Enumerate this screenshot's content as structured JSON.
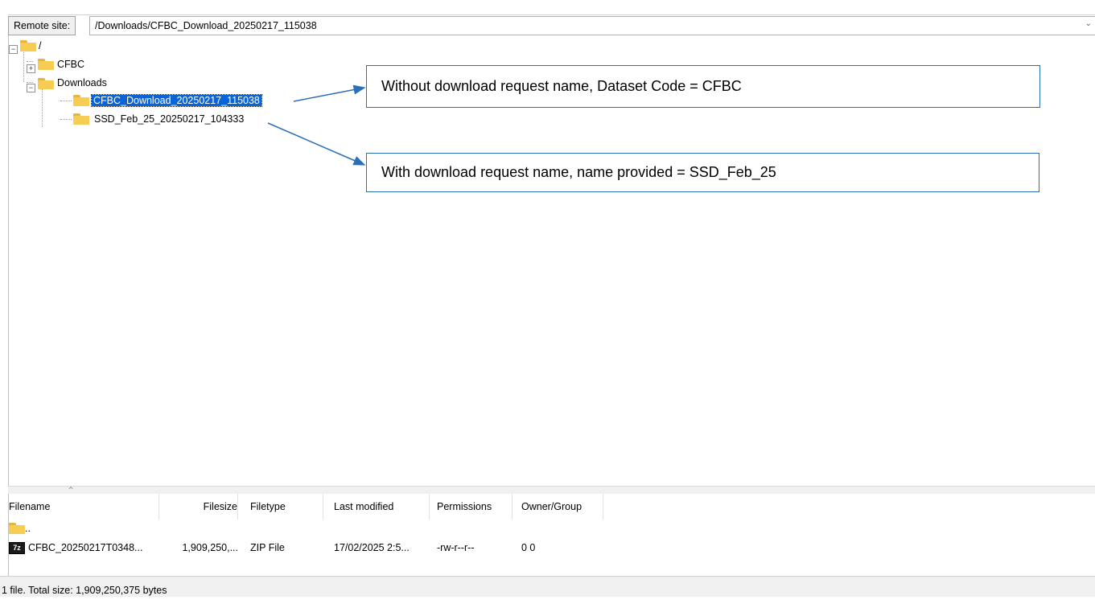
{
  "remote_site": {
    "label": "Remote site:",
    "path": "/Downloads/CFBC_Download_20250217_115038"
  },
  "tree": {
    "root": "/",
    "cfbc": "CFBC",
    "downloads": "Downloads",
    "child1": "CFBC_Download_20250217_115038",
    "child2": "SSD_Feb_25_20250217_104333"
  },
  "callouts": {
    "first": "Without download request name, Dataset Code = CFBC",
    "second": "With download request name, name provided = SSD_Feb_25"
  },
  "file_list": {
    "columns": [
      "Filename",
      "Filesize",
      "Filetype",
      "Last modified",
      "Permissions",
      "Owner/Group"
    ],
    "parent_row": "..",
    "rows": [
      {
        "filename": "CFBC_20250217T0348...",
        "filesize": "1,909,250,...",
        "filetype": "ZIP File",
        "last_modified": "17/02/2025 2:5...",
        "permissions": "-rw-r--r--",
        "owner_group": "0 0"
      }
    ],
    "zip_icon_text": "7z"
  },
  "status": "1 file. Total size: 1,909,250,375 bytes",
  "colors": {
    "selection": "#0a64d6",
    "callout_border": "#2a6fb8",
    "arrow": "#2a6fb8",
    "folder": "#f7cc52"
  },
  "icons": [
    "folder-icon",
    "expand-icon",
    "collapse-icon",
    "zip-file-icon",
    "sort-ascending-icon",
    "chevron-down-icon"
  ]
}
